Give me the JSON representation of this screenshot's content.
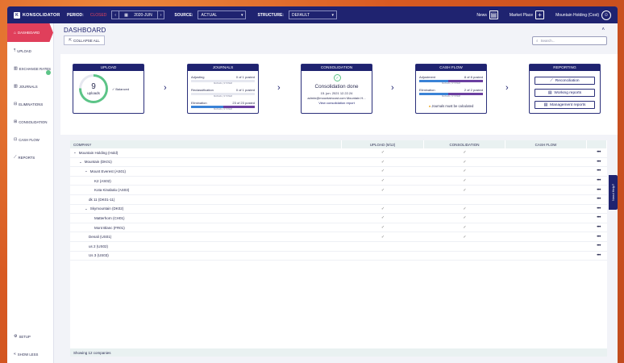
{
  "topbar": {
    "logo": "KONSOLIDATOR",
    "period_label": "PERIOD:",
    "period_status": "CLOSED",
    "period_value": "2020-JUN",
    "source_label": "SOURCE:",
    "source_value": "ACTUAL",
    "structure_label": "STRUCTURE:",
    "structure_value": "DEFAULT",
    "news": "News",
    "market_place": "Market Place",
    "user": "Mountain Holding (Cost)"
  },
  "sidebar": {
    "items": [
      {
        "label": "DASHBOARD",
        "icon": "home-icon"
      },
      {
        "label": "UPLOAD",
        "icon": "upload-icon"
      },
      {
        "label": "EXCHANGE RATES",
        "icon": "exchange-icon"
      },
      {
        "label": "JOURNALS",
        "icon": "journal-icon"
      },
      {
        "label": "ELIMINATIONS",
        "icon": "elimination-icon"
      },
      {
        "label": "CONSOLIDATION",
        "icon": "consolidation-icon"
      },
      {
        "label": "CASH FLOW",
        "icon": "cashflow-icon"
      },
      {
        "label": "REPORTS",
        "icon": "reports-icon"
      }
    ],
    "setup": "SETUP",
    "show_less": "SHOW LESS"
  },
  "main": {
    "title": "DASHBOARD",
    "collapse_all": "COLLAPSE ALL",
    "search_placeholder": "Search..."
  },
  "flow": {
    "upload": {
      "title": "UPLOAD",
      "count": "9",
      "unit": "uploads",
      "balanced": "Balanced",
      "progress": 0.75
    },
    "journals": {
      "title": "JOURNALS",
      "rows": [
        {
          "label": "Adjusting",
          "status": "0 of 1 posted",
          "sub": "MANUAL | SYSTEM"
        },
        {
          "label": "Reclassification",
          "status": "0 of 1 posted",
          "sub": "MANUAL | SYSTEM"
        },
        {
          "label": "Elimination",
          "status": "23 of 23 posted",
          "sub": "MANUAL | SYSTEM"
        }
      ]
    },
    "consolidation": {
      "title": "CONSOLIDATION",
      "status": "Consolidation done",
      "date": "15. jun. 2021 12.22.24",
      "user": "admin@mountaincost.com Mountain H...",
      "link": "View consolidation report"
    },
    "cashflow": {
      "title": "CASH FLOW",
      "rows": [
        {
          "label": "Adjustment",
          "status": "8 of 8 posted",
          "sub": "MANUAL | SYSTEM"
        },
        {
          "label": "Elimination",
          "status": "2 of 2 posted",
          "sub": "MANUAL | SYSTEM"
        }
      ],
      "warning": "Journals must be calculated"
    },
    "reporting": {
      "title": "REPORTING",
      "buttons": [
        "Reconciliation",
        "Working reports",
        "Management reports"
      ]
    }
  },
  "table": {
    "headers": [
      "COMPANY",
      "UPLOAD (9/12)",
      "CONSOLIDATION",
      "CASH FLOW"
    ],
    "rows": [
      {
        "name": "Mountain Holding (Hold)",
        "indent": 0,
        "toggle": true,
        "upload": true,
        "cons": true
      },
      {
        "name": "Mountain (DK01)",
        "indent": 1,
        "toggle": true,
        "upload": true,
        "cons": true
      },
      {
        "name": "Mount Everest (AS01)",
        "indent": 2,
        "toggle": true,
        "upload": true,
        "cons": true
      },
      {
        "name": "K2 (AS02)",
        "indent": 3,
        "toggle": false,
        "upload": true,
        "cons": true
      },
      {
        "name": "Kota Kinabalu (AS03)",
        "indent": 3,
        "toggle": false,
        "upload": true,
        "cons": true
      },
      {
        "name": "dk 11 (DK01-11)",
        "indent": 2,
        "toggle": false,
        "upload": false,
        "cons": false
      },
      {
        "name": "Skymountain (DK02)",
        "indent": 2,
        "toggle": true,
        "upload": true,
        "cons": true
      },
      {
        "name": "Matterhorn (CH01)",
        "indent": 3,
        "toggle": false,
        "upload": true,
        "cons": true
      },
      {
        "name": "Mont Blanc (FR01)",
        "indent": 3,
        "toggle": false,
        "upload": true,
        "cons": true
      },
      {
        "name": "Denali (US01)",
        "indent": 2,
        "toggle": false,
        "upload": true,
        "cons": true
      },
      {
        "name": "us 2 (US02)",
        "indent": 2,
        "toggle": false,
        "upload": false,
        "cons": false
      },
      {
        "name": "Us 3 (US03)",
        "indent": 2,
        "toggle": false,
        "upload": false,
        "cons": false
      }
    ],
    "footer": "Showing 12 companies"
  },
  "help": "Need Help?"
}
